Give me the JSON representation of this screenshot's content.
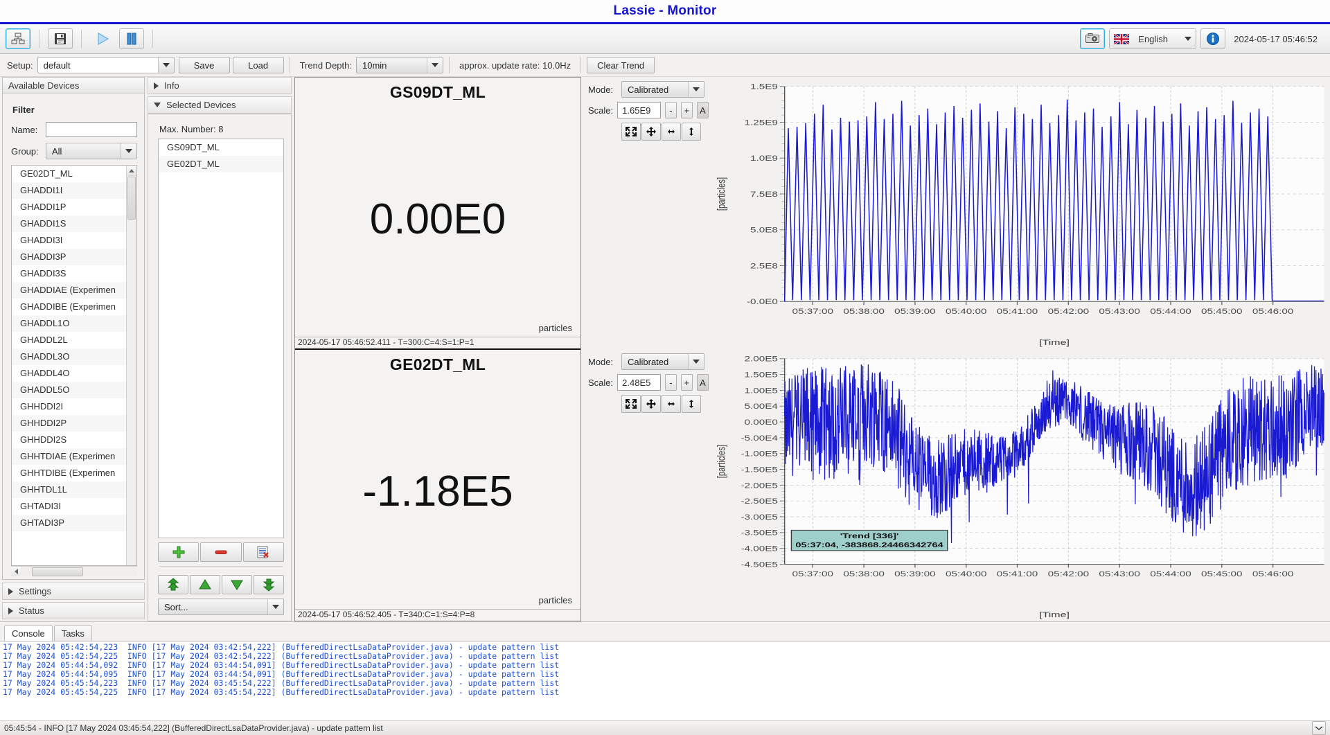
{
  "window": {
    "title": "Lassie - Monitor"
  },
  "toolbar": {
    "screenshot_icon": "camera-icon",
    "save_icon": "floppy-disk-icon",
    "devices_icon": "devices-tree-icon",
    "play_icon": "play-icon",
    "pause_icon": "pause-icon",
    "language": "English",
    "info_icon": "info-icon",
    "timestamp": "2024-05-17 05:46:52"
  },
  "setup_row": {
    "setup_label": "Setup:",
    "setup_value": "default",
    "save_label": "Save",
    "load_label": "Load",
    "trend_depth_label": "Trend Depth:",
    "trend_depth_value": "10min",
    "update_rate": "approx. update rate:  10.0Hz",
    "clear_trend_label": "Clear Trend"
  },
  "available_devices": {
    "header": "Available Devices",
    "filter_title": "Filter",
    "name_label": "Name:",
    "name_value": "",
    "group_label": "Group:",
    "group_value": "All",
    "items": [
      "GE02DT_ML",
      "GHADDI1I",
      "GHADDI1P",
      "GHADDI1S",
      "GHADDI3I",
      "GHADDI3P",
      "GHADDI3S",
      "GHADDIAE (Experimen",
      "GHADDIBE (Experimen",
      "GHADDL1O",
      "GHADDL2L",
      "GHADDL3O",
      "GHADDL4O",
      "GHADDL5O",
      "GHHDDI2I",
      "GHHDDI2P",
      "GHHDDI2S",
      "GHHTDIAE (Experimen",
      "GHHTDIBE (Experimen",
      "GHHTDL1L",
      "GHTADI3I",
      "GHTADI3P"
    ]
  },
  "info_section": {
    "label": "Info"
  },
  "selected_devices": {
    "header": "Selected Devices",
    "max_number": "Max. Number: 8",
    "items": [
      "GS09DT_ML",
      "GE02DT_ML"
    ],
    "add_icon": "plus-icon",
    "remove_icon": "minus-icon",
    "clear_icon": "clear-list-icon",
    "move_top_icon": "move-to-top-icon",
    "move_up_icon": "move-up-icon",
    "move_down_icon": "move-down-icon",
    "move_bottom_icon": "move-to-bottom-icon",
    "sort_label": "Sort..."
  },
  "settings_section": {
    "label": "Settings"
  },
  "status_section": {
    "label": "Status"
  },
  "displays": [
    {
      "title": "GS09DT_ML",
      "value": "0.00E0",
      "unit": "particles",
      "footer": "2024-05-17 05:46:52.411 - T=300:C=4:S=1:P=1"
    },
    {
      "title": "GE02DT_ML",
      "value": "-1.18E5",
      "unit": "particles",
      "footer": "2024-05-17 05:46:52.405 - T=340:C=1:S=4:P=8"
    }
  ],
  "chart_controls": [
    {
      "mode_label": "Mode:",
      "mode_value": "Calibrated",
      "scale_label": "Scale:",
      "scale_value": "1.65E9",
      "minus_label": "-",
      "plus_label": "+",
      "auto_label": "A",
      "zoom_icons": [
        "zoom-fit-icon",
        "pan-icon",
        "zoom-horizontal-icon",
        "zoom-vertical-icon"
      ]
    },
    {
      "mode_label": "Mode:",
      "mode_value": "Calibrated",
      "scale_label": "Scale:",
      "scale_value": "2.48E5",
      "minus_label": "-",
      "plus_label": "+",
      "auto_label": "A",
      "zoom_icons": [
        "zoom-fit-icon",
        "pan-icon",
        "zoom-horizontal-icon",
        "zoom-vertical-icon"
      ]
    }
  ],
  "chart_data": [
    {
      "type": "line",
      "title": "GS09DT_ML trend",
      "series_name": "Trend",
      "color": "#1a1ad2",
      "xlabel": "[Time]",
      "ylabel": "[particles]",
      "xticks": [
        "05:37:00",
        "05:38:00",
        "05:39:00",
        "05:40:00",
        "05:41:00",
        "05:42:00",
        "05:43:00",
        "05:44:00",
        "05:45:00",
        "05:46:00"
      ],
      "yticks": [
        "-0.0E0",
        "2.5E8",
        "5.0E8",
        "7.5E8",
        "1.0E9",
        "1.25E9",
        "1.5E9"
      ],
      "ylim": [
        0,
        1650000000
      ],
      "grid": true,
      "description": "Dense sawtooth: ~56 spikes from 0 up to 1.3E9-1.55E9 between 05:37 and 05:45:50, then flat near 0 to the right edge",
      "peaks": [
        1330000000.0,
        1340000000.0,
        1370000000.0,
        1440000000.0,
        1510000000.0,
        1320000000.0,
        1410000000.0,
        1380000000.0,
        1390000000.0,
        1420000000.0,
        1530000000.0,
        1400000000.0,
        1440000000.0,
        1540000000.0,
        1350000000.0,
        1430000000.0,
        1480000000.0,
        1360000000.0,
        1450000000.0,
        1500000000.0,
        1410000000.0,
        1470000000.0,
        1520000000.0,
        1380000000.0,
        1460000000.0,
        1330000000.0,
        1490000000.0,
        1440000000.0,
        1400000000.0,
        1510000000.0,
        1370000000.0,
        1430000000.0,
        1550000000.0,
        1390000000.0,
        1450000000.0,
        1480000000.0,
        1340000000.0,
        1420000000.0,
        1530000000.0,
        1360000000.0,
        1470000000.0,
        1410000000.0,
        1500000000.0,
        1380000000.0,
        1440000000.0,
        1520000000.0,
        1350000000.0,
        1460000000.0,
        1490000000.0,
        1400000000.0,
        1430000000.0,
        1540000000.0,
        1370000000.0,
        1450000000.0,
        1480000000.0,
        1420000000.0
      ]
    },
    {
      "type": "line",
      "title": "GE02DT_ML trend",
      "series_name": "Trend",
      "color": "#1a1ad2",
      "xlabel": "[Time]",
      "ylabel": "[particles]",
      "xticks": [
        "05:37:00",
        "05:38:00",
        "05:39:00",
        "05:40:00",
        "05:41:00",
        "05:42:00",
        "05:43:00",
        "05:44:00",
        "05:45:00",
        "05:46:00"
      ],
      "yticks": [
        "2.00E5",
        "1.50E5",
        "1.00E5",
        "5.00E4",
        "0.00E0",
        "-5.00E4",
        "-1.00E5",
        "-1.50E5",
        "-2.00E5",
        "-2.50E5",
        "-3.00E5",
        "-3.50E5",
        "-4.00E5",
        "-4.50E5"
      ],
      "ylim": [
        -480000,
        230000
      ],
      "grid": true,
      "description": "Dense high-frequency noise band oscillating roughly between -4.5E5 and +2.0E5, densest between -2.5E5 and +1.5E5",
      "tooltip": {
        "line1": "'Trend [336]'",
        "line2": "05:37:04, -383868.24466342764"
      }
    }
  ],
  "console": {
    "tabs": [
      "Console",
      "Tasks"
    ],
    "active_tab": "Console",
    "lines": [
      "17 May 2024 05:42:54,223  INFO [17 May 2024 03:42:54,222] (BufferedDirectLsaDataProvider.java) - update pattern list",
      "17 May 2024 05:42:54,225  INFO [17 May 2024 03:42:54,222] (BufferedDirectLsaDataProvider.java) - update pattern list",
      "17 May 2024 05:44:54,092  INFO [17 May 2024 03:44:54,091] (BufferedDirectLsaDataProvider.java) - update pattern list",
      "17 May 2024 05:44:54,095  INFO [17 May 2024 03:44:54,091] (BufferedDirectLsaDataProvider.java) - update pattern list",
      "17 May 2024 05:45:54,223  INFO [17 May 2024 03:45:54,222] (BufferedDirectLsaDataProvider.java) - update pattern list",
      "17 May 2024 05:45:54,225  INFO [17 May 2024 03:45:54,222] (BufferedDirectLsaDataProvider.java) - update pattern list"
    ]
  },
  "statusbar": {
    "message": "05:45:54 -  INFO [17 May 2024 03:45:54,222] (BufferedDirectLsaDataProvider.java) - update pattern list",
    "collapse_icon": "chevron-down-icon"
  }
}
